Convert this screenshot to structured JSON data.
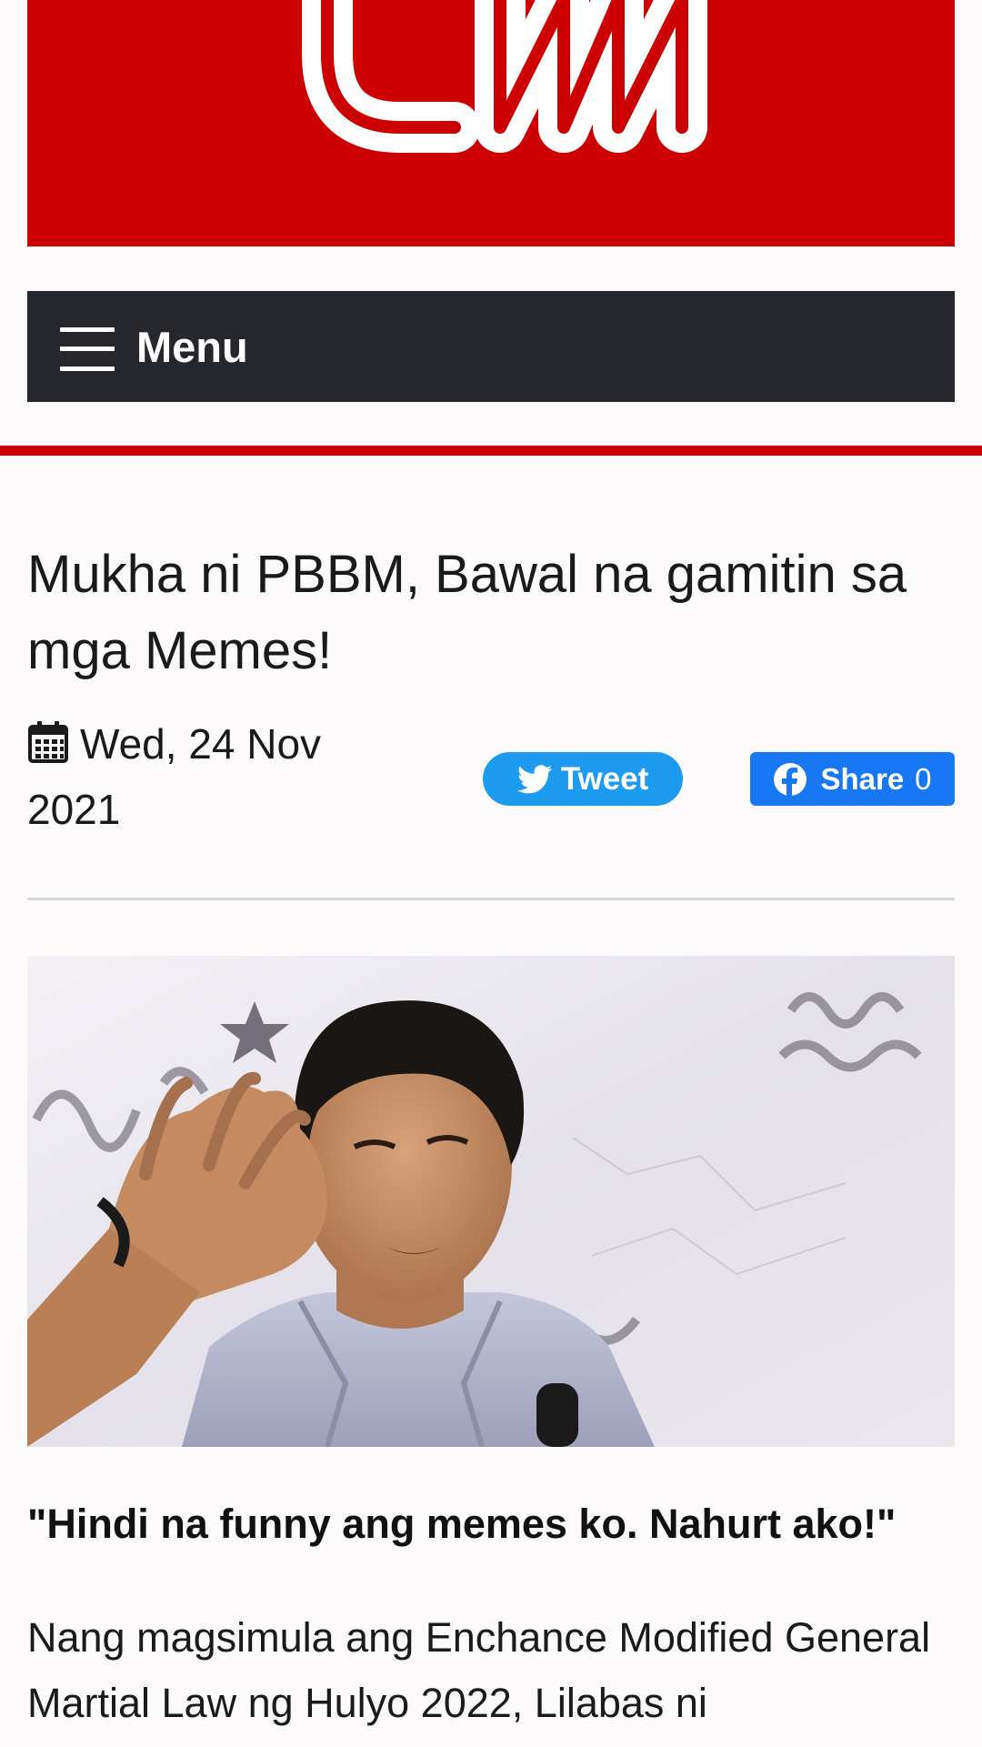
{
  "site": {
    "logo_text": "CNN",
    "brand_color": "#cc0001"
  },
  "nav": {
    "menu_label": "Menu",
    "menu_icon": "hamburger-icon"
  },
  "article": {
    "title": "Mukha ni PBBM, Bawal na gamitin sa mga Memes!",
    "date": "Wed, 24 Nov 2021",
    "date_icon": "calendar-icon",
    "image_alt": "Man in barong gesturing while speaking into a microphone",
    "quote": "\"Hindi na funny ang memes ko. Nahurt ako!\"",
    "body": "Nang magsimula ang Enchance Modified General Martial Law ng Hulyo 2022, Lilabas ni"
  },
  "social": {
    "tweet_label": "Tweet",
    "tweet_icon": "twitter-bird-icon",
    "tweet_color": "#1d9bf0",
    "share_label": "Share",
    "share_count": "0",
    "share_icon": "facebook-icon",
    "share_color": "#1877f2"
  }
}
